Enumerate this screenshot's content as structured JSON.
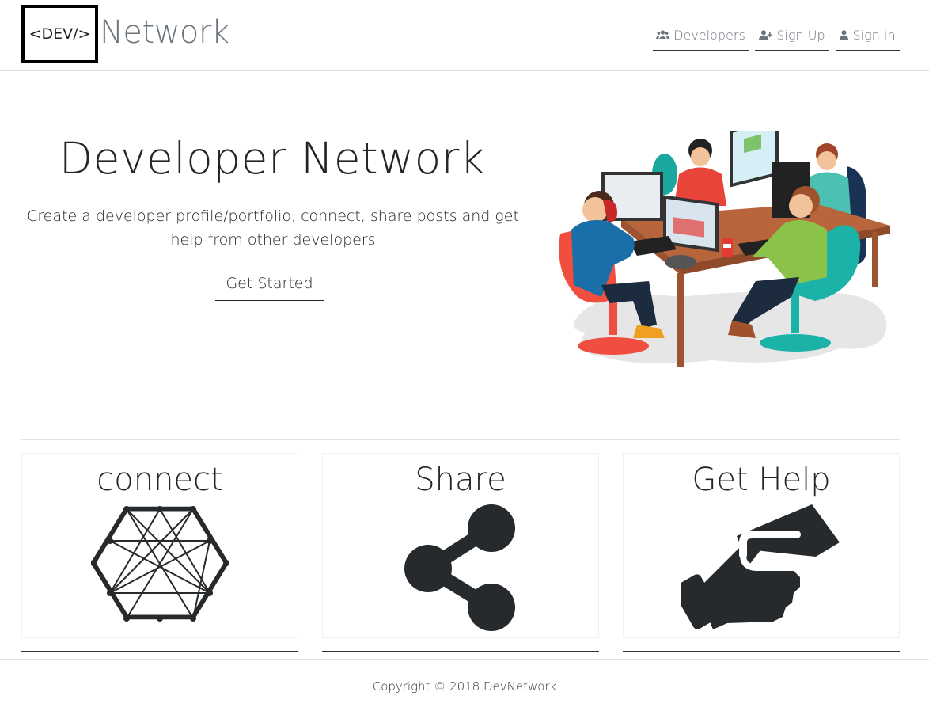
{
  "header": {
    "logo_text": "<DEV/>",
    "brand": "Network",
    "nav": [
      {
        "label": "Developers",
        "icon": "users-icon"
      },
      {
        "label": "Sign Up",
        "icon": "user-plus-icon"
      },
      {
        "label": "Sign in",
        "icon": "user-icon"
      }
    ]
  },
  "hero": {
    "title": "Developer Network",
    "subtitle": "Create a developer profile/portfolio, connect, share posts and get help from other developers",
    "cta_label": "Get Started",
    "illustration": "developers-at-desk-illustration"
  },
  "cards": [
    {
      "title": "connect",
      "icon": "network-graph-icon"
    },
    {
      "title": "Share",
      "icon": "share-icon"
    },
    {
      "title": "Get Help",
      "icon": "handshake-icon"
    }
  ],
  "footer": {
    "copyright": "Copyright © 2018 DevNetwork"
  },
  "colors": {
    "brand_gray": "#6c757d",
    "text_dark": "#212529",
    "icon_dark": "#272a2d",
    "divider": "#e1e1e1"
  }
}
